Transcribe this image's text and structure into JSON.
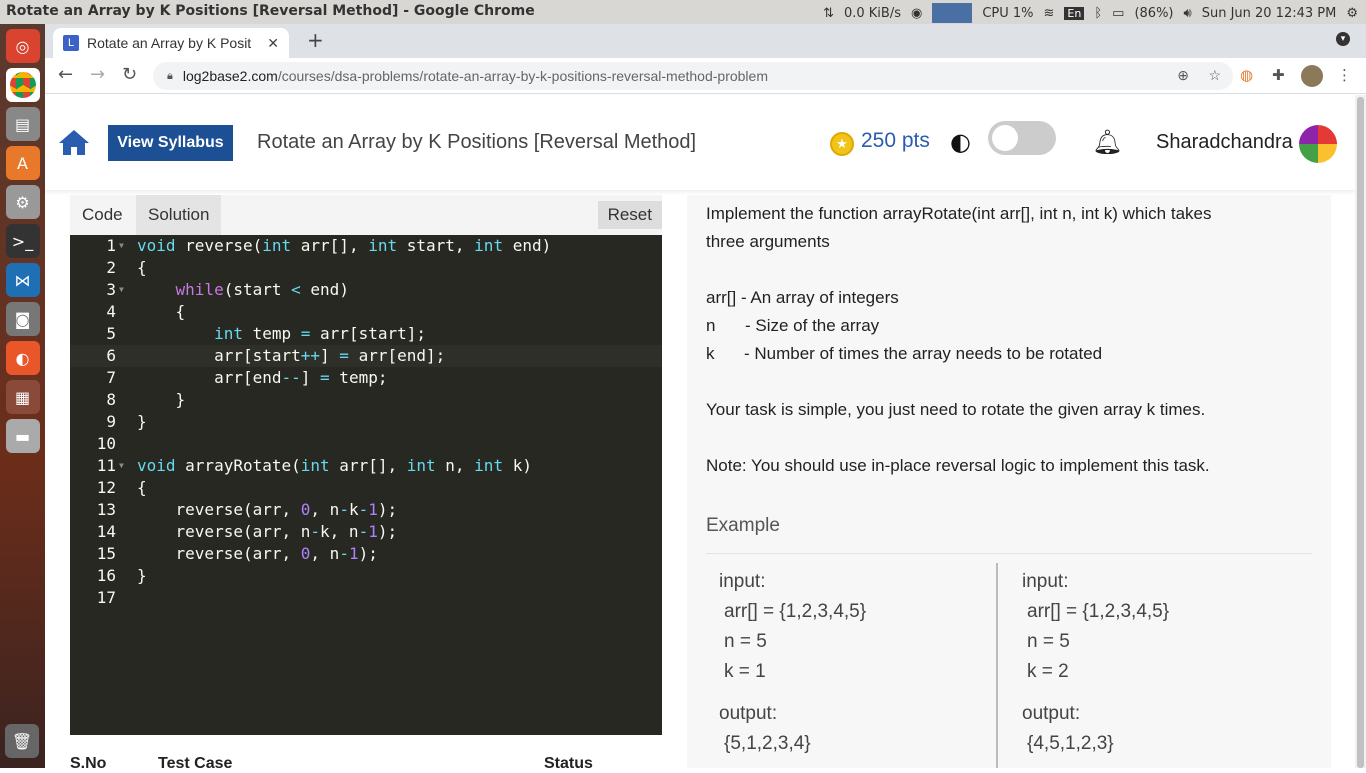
{
  "os": {
    "window_title": "Rotate an Array by K Positions [Reversal Method] - Google Chrome",
    "net_speed": "0.0 KiB/s",
    "cpu": "CPU 1%",
    "lang": "En",
    "battery": "(86%)",
    "datetime": "Sun Jun 20 12:43 PM"
  },
  "browser": {
    "tab_title": "Rotate an Array by K Posit",
    "url_host": "log2base2.com",
    "url_path": "/courses/dsa-problems/rotate-an-array-by-k-positions-reversal-method-problem"
  },
  "header": {
    "syllabus_label": "View Syllabus",
    "page_title": "Rotate an Array by K Positions [Reversal Method]",
    "points": "250 pts",
    "username": "Sharadchandra"
  },
  "editor": {
    "tabs": [
      "Code",
      "Solution"
    ],
    "active_tab": "Solution",
    "reset_label": "Reset",
    "line_numbers": [
      "1",
      "2",
      "3",
      "4",
      "5",
      "6",
      "7",
      "8",
      "9",
      "10",
      "11",
      "12",
      "13",
      "14",
      "15",
      "16",
      "17"
    ],
    "highlighted_line": "6"
  },
  "results": {
    "col_sno": "S.No",
    "col_case": "Test Case",
    "col_status": "Status"
  },
  "problem": {
    "intro_1": "Implement the function arrayRotate(int arr[], int n, int k) which takes",
    "intro_2": "three arguments",
    "arg_arr": "arr[] - An array of integers",
    "arg_n_key": "n",
    "arg_n_val": "- Size of the array",
    "arg_k_key": "k",
    "arg_k_val": "- Number of times the array needs to be rotated",
    "task": "Your task is simple, you just need to rotate the given array k times.",
    "note": "Note: You should use in-place reversal logic to implement this task.",
    "example_label": "Example",
    "examples": [
      {
        "input_label": "input:",
        "arr": "arr[] = {1,2,3,4,5}",
        "n": "n = 5",
        "k": "k = 1",
        "output_label": "output:",
        "output": "{5,1,2,3,4}"
      },
      {
        "input_label": "input:",
        "arr": "arr[] = {1,2,3,4,5}",
        "n": "n = 5",
        "k": "k = 2",
        "output_label": "output:",
        "output": "{4,5,1,2,3}"
      }
    ]
  },
  "colors": {
    "accent": "#1c4f94",
    "editor_bg": "#272822",
    "points": "#2a5db0"
  }
}
